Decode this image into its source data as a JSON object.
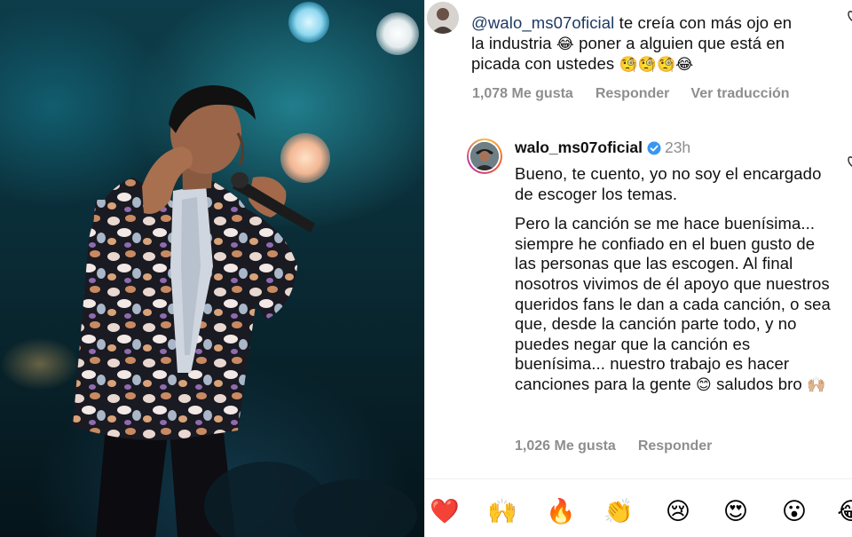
{
  "comment": {
    "mention": "@walo_ms07oficial",
    "line1_rest": " te creía con más ojo en",
    "line2_a": "la industria ",
    "line2_emoji": "😂",
    "line2_b": " poner a alguien que está en",
    "line3_text": "picada con ustedes ",
    "line3_emojis": "🧐🧐🧐😂",
    "likes": "1,078 Me gusta",
    "reply_action": "Responder",
    "translate_action": "Ver traducción"
  },
  "reply": {
    "username": "walo_ms07oficial",
    "time": "23h",
    "para1": "Bueno, te cuento, yo no soy el encargado de escoger los temas.",
    "para2_a": "Pero la canción se me hace buenísima... siempre he confiado en el buen gusto de las personas que las escogen. Al final nosotros vivimos de él apoyo que nuestros queridos fans le dan a cada canción, o sea que, desde la canción parte todo, y no puedes negar que la canción es buenísima... nuestro trabajo es hacer canciones para la gente ",
    "para2_emoji": "😊",
    "para2_b": " saludos bro ",
    "para2_emoji2": "🙌🏼",
    "likes": "1,026 Me gusta",
    "reply_action": "Responder"
  },
  "reactions": [
    "❤️",
    "🙌",
    "🔥",
    "👏",
    "😢",
    "😍",
    "😮",
    "😂"
  ],
  "icons": {
    "verified": "verified-badge-icon",
    "heart": "heart-outline-icon"
  },
  "colors": {
    "mention": "#1e3a63",
    "meta": "#8e8e8e",
    "verified": "#3897f0"
  }
}
